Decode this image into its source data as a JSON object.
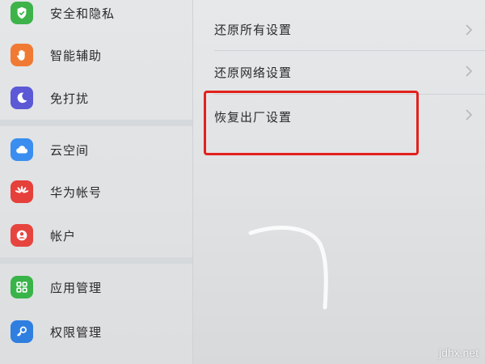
{
  "sidebar": {
    "items": [
      {
        "label": "安全和隐私",
        "icon": "shield-icon",
        "color": "#3db34a"
      },
      {
        "label": "智能辅助",
        "icon": "hand-icon",
        "color": "#f07a33"
      },
      {
        "label": "免打扰",
        "icon": "moon-icon",
        "color": "#5b59d6"
      },
      {
        "label": "云空间",
        "icon": "cloud-icon",
        "color": "#3a8ef0"
      },
      {
        "label": "华为帐号",
        "icon": "huawei-logo-icon",
        "color": "#e6403a"
      },
      {
        "label": "帐户",
        "icon": "account-icon",
        "color": "#e6453f"
      },
      {
        "label": "应用管理",
        "icon": "apps-grid-icon",
        "color": "#39b449"
      },
      {
        "label": "权限管理",
        "icon": "key-icon",
        "color": "#2f7fe0"
      }
    ]
  },
  "content": {
    "rows": [
      {
        "label": "还原所有设置"
      },
      {
        "label": "还原网络设置"
      },
      {
        "label": "恢复出厂设置"
      }
    ]
  },
  "colors": {
    "highlight": "#e3211c"
  },
  "watermark": "jdhx.net"
}
